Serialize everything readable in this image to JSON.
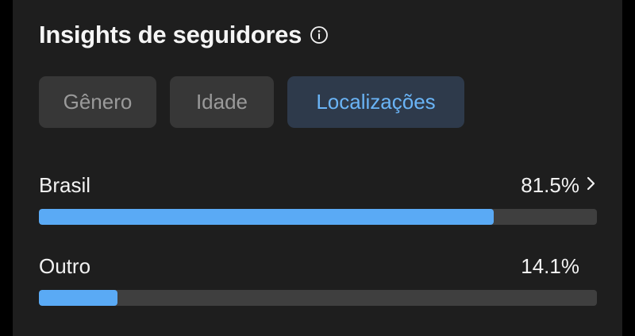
{
  "header": {
    "title": "Insights de seguidores",
    "info_icon": "info-circle-icon"
  },
  "tabs": [
    {
      "label": "Gênero",
      "active": false
    },
    {
      "label": "Idade",
      "active": false
    },
    {
      "label": "Localizações",
      "active": true
    }
  ],
  "locations": [
    {
      "name": "Brasil",
      "percent_label": "81.5%",
      "percent": 81.5,
      "has_chevron": true
    },
    {
      "name": "Outro",
      "percent_label": "14.1%",
      "percent": 14.1,
      "has_chevron": false
    }
  ],
  "colors": {
    "background": "#1e1e1e",
    "bar_fill": "#5aaaf5",
    "bar_track": "#3f3f3f",
    "active_tab_text": "#6ab4f6",
    "active_tab_bg": "#2e3a4b"
  }
}
